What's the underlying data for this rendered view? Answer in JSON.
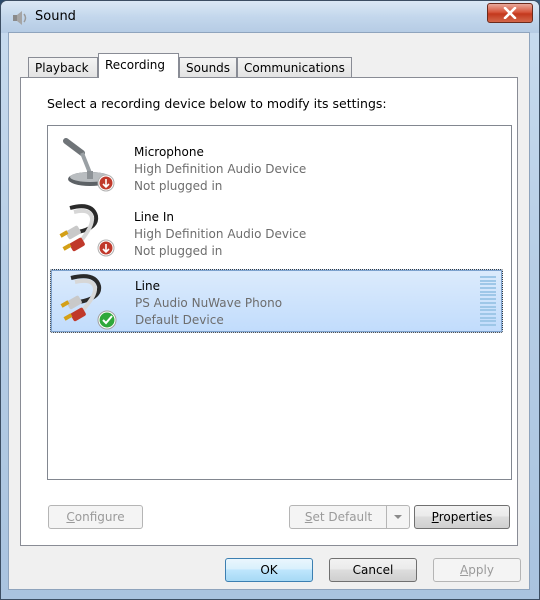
{
  "window": {
    "title": "Sound"
  },
  "tabs": [
    {
      "label": "Playback",
      "active": false
    },
    {
      "label": "Recording",
      "active": true
    },
    {
      "label": "Sounds",
      "active": false
    },
    {
      "label": "Communications",
      "active": false
    }
  ],
  "instruction": "Select a recording device below to modify its settings:",
  "devices": [
    {
      "name": "Microphone",
      "description": "High Definition Audio Device",
      "status": "Not plugged in",
      "icon": "microphone-icon",
      "badge": "unplugged-badge-icon",
      "selected": false
    },
    {
      "name": "Line In",
      "description": "High Definition Audio Device",
      "status": "Not plugged in",
      "icon": "rca-cable-icon",
      "badge": "unplugged-badge-icon",
      "selected": false
    },
    {
      "name": "Line",
      "description": "PS Audio NuWave Phono",
      "status": "Default Device",
      "icon": "rca-cable-icon",
      "badge": "default-check-icon",
      "selected": true
    }
  ],
  "buttons": {
    "configure": {
      "prefix": "",
      "mnemonic": "C",
      "rest": "onfigure",
      "enabled": false
    },
    "set_default": {
      "prefix": "",
      "mnemonic": "S",
      "rest": "et Default",
      "enabled": false
    },
    "properties": {
      "prefix": "",
      "mnemonic": "P",
      "rest": "roperties",
      "enabled": true
    },
    "ok": {
      "label": "OK"
    },
    "cancel": {
      "label": "Cancel"
    },
    "apply": {
      "prefix": "",
      "mnemonic": "A",
      "rest": "pply",
      "enabled": false
    }
  },
  "colors": {
    "selection": "#c1dcfc",
    "status_unplugged": "#c0392b",
    "status_default": "#2fa83a"
  }
}
